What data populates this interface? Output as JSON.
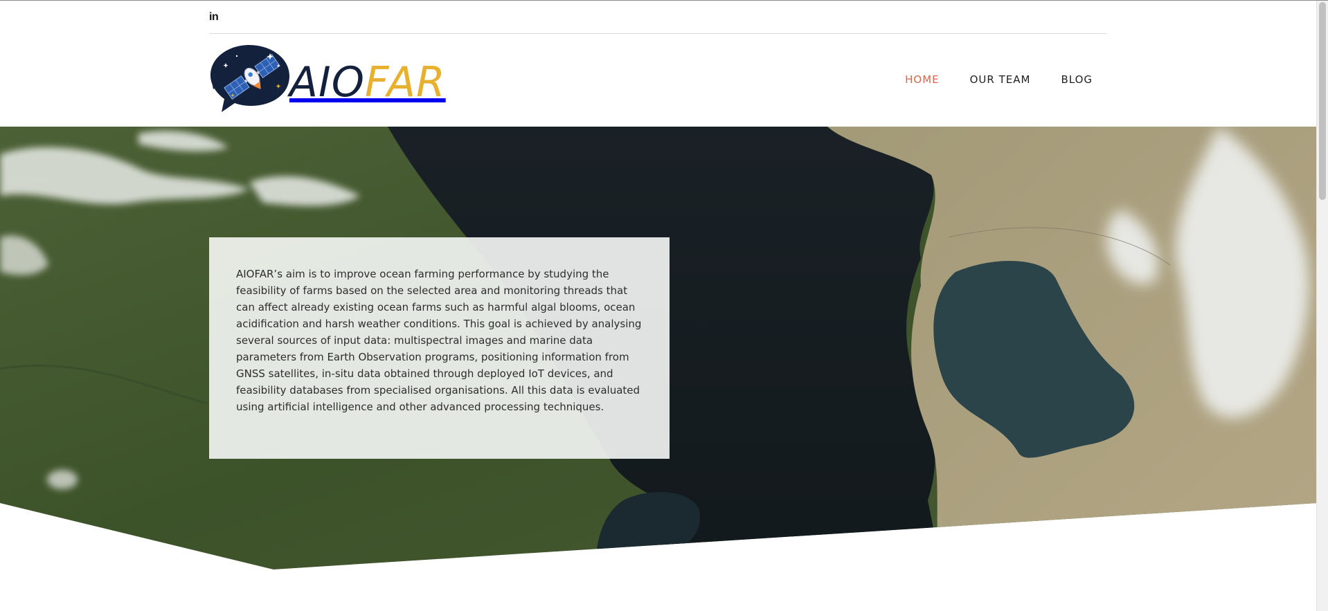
{
  "social": {
    "linkedin_label": "in"
  },
  "logo": {
    "part1": "AIO",
    "part2": "FAR"
  },
  "nav": {
    "items": [
      {
        "label": "HOME",
        "active": true
      },
      {
        "label": "OUR TEAM",
        "active": false
      },
      {
        "label": "BLOG",
        "active": false
      }
    ]
  },
  "hero": {
    "text": "AIOFAR’s aim is to improve ocean farming performance by studying the feasibility of farms based on the selected area and monitoring threads that can affect already existing ocean farms such as harmful algal blooms, ocean acidification and harsh weather conditions. This goal is achieved by analysing several sources of input data: multispectral images and marine data parameters from Earth Observation programs, positioning information from GNSS satellites, in-situ data obtained through deployed IoT devices, and feasibility databases from specialised organisations. All this data is evaluated using artificial intelligence and other advanced processing techniques."
  },
  "colors": {
    "accent": "#d9644b",
    "brand_navy": "#14213d",
    "brand_gold": "#e7b12f"
  }
}
